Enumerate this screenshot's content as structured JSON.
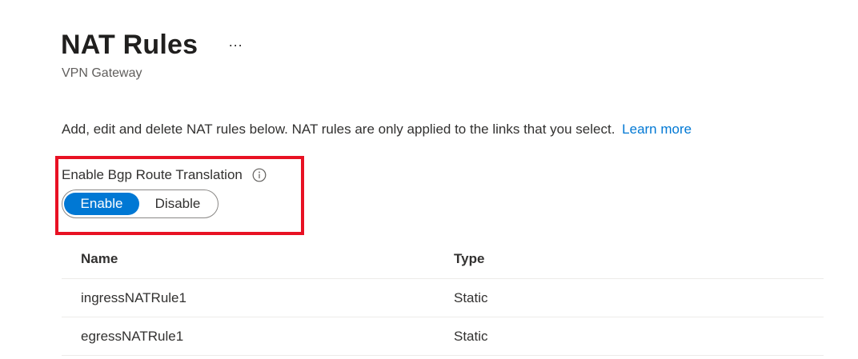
{
  "header": {
    "title": "NAT Rules",
    "more_label": "···",
    "subtitle": "VPN Gateway"
  },
  "description": {
    "text": "Add, edit and delete NAT rules below. NAT rules are only applied to the links that you select.",
    "link_label": "Learn more"
  },
  "bgp_translation": {
    "label": "Enable Bgp Route Translation",
    "info_icon": "info-icon",
    "options": [
      "Enable",
      "Disable"
    ],
    "selected": "Enable"
  },
  "table": {
    "columns": [
      "Name",
      "Type"
    ],
    "rows": [
      [
        "ingressNATRule1",
        "Static"
      ],
      [
        "egressNATRule1",
        "Static"
      ]
    ]
  },
  "colors": {
    "accent": "#0078d4",
    "highlight": "#e81123"
  }
}
